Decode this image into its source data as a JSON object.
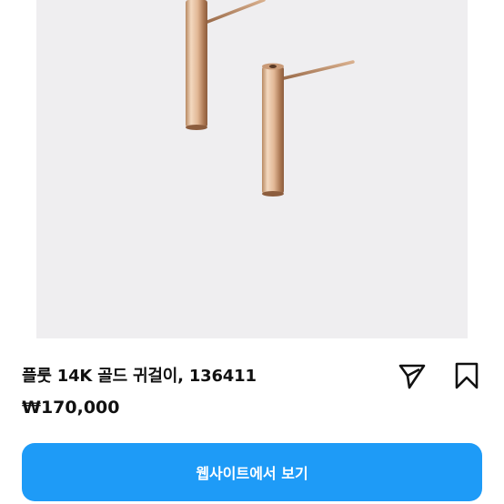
{
  "product": {
    "title": "플룻 14K 골드 귀걸이, 136411",
    "price": "₩170,000"
  },
  "actions": {
    "website_button_label": "웹사이트에서 보기",
    "share_icon": "send-arrow-icon",
    "save_icon": "bookmark-icon"
  },
  "colors": {
    "image_background": "#efeef0",
    "button": "#1e9bf7",
    "text": "#111111"
  }
}
